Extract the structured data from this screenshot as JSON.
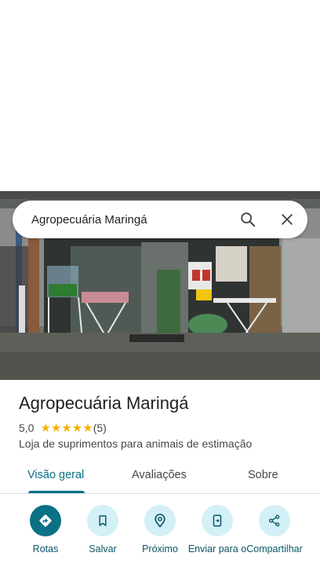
{
  "search": {
    "query": "Agropecuária Maringá"
  },
  "place": {
    "name": "Agropecuária Maringá",
    "rating": "5,0",
    "stars": "★★★★★",
    "review_count": "(5)",
    "category": "Loja de suprimentos para animais de estimação"
  },
  "tabs": [
    "Visão geral",
    "Avaliações",
    "Sobre"
  ],
  "active_tab": "Visão geral",
  "actions": [
    {
      "label": "Rotas",
      "icon": "directions-icon"
    },
    {
      "label": "Salvar",
      "icon": "bookmark-icon"
    },
    {
      "label": "Próximo",
      "icon": "nearby-icon"
    },
    {
      "label": "Enviar para o",
      "icon": "send-to-phone-icon"
    },
    {
      "label": "Compartilhar",
      "icon": "share-icon"
    }
  ],
  "colors": {
    "accent": "#0b7185",
    "chip_bg": "#d3f0f7",
    "star": "#f4b400"
  }
}
